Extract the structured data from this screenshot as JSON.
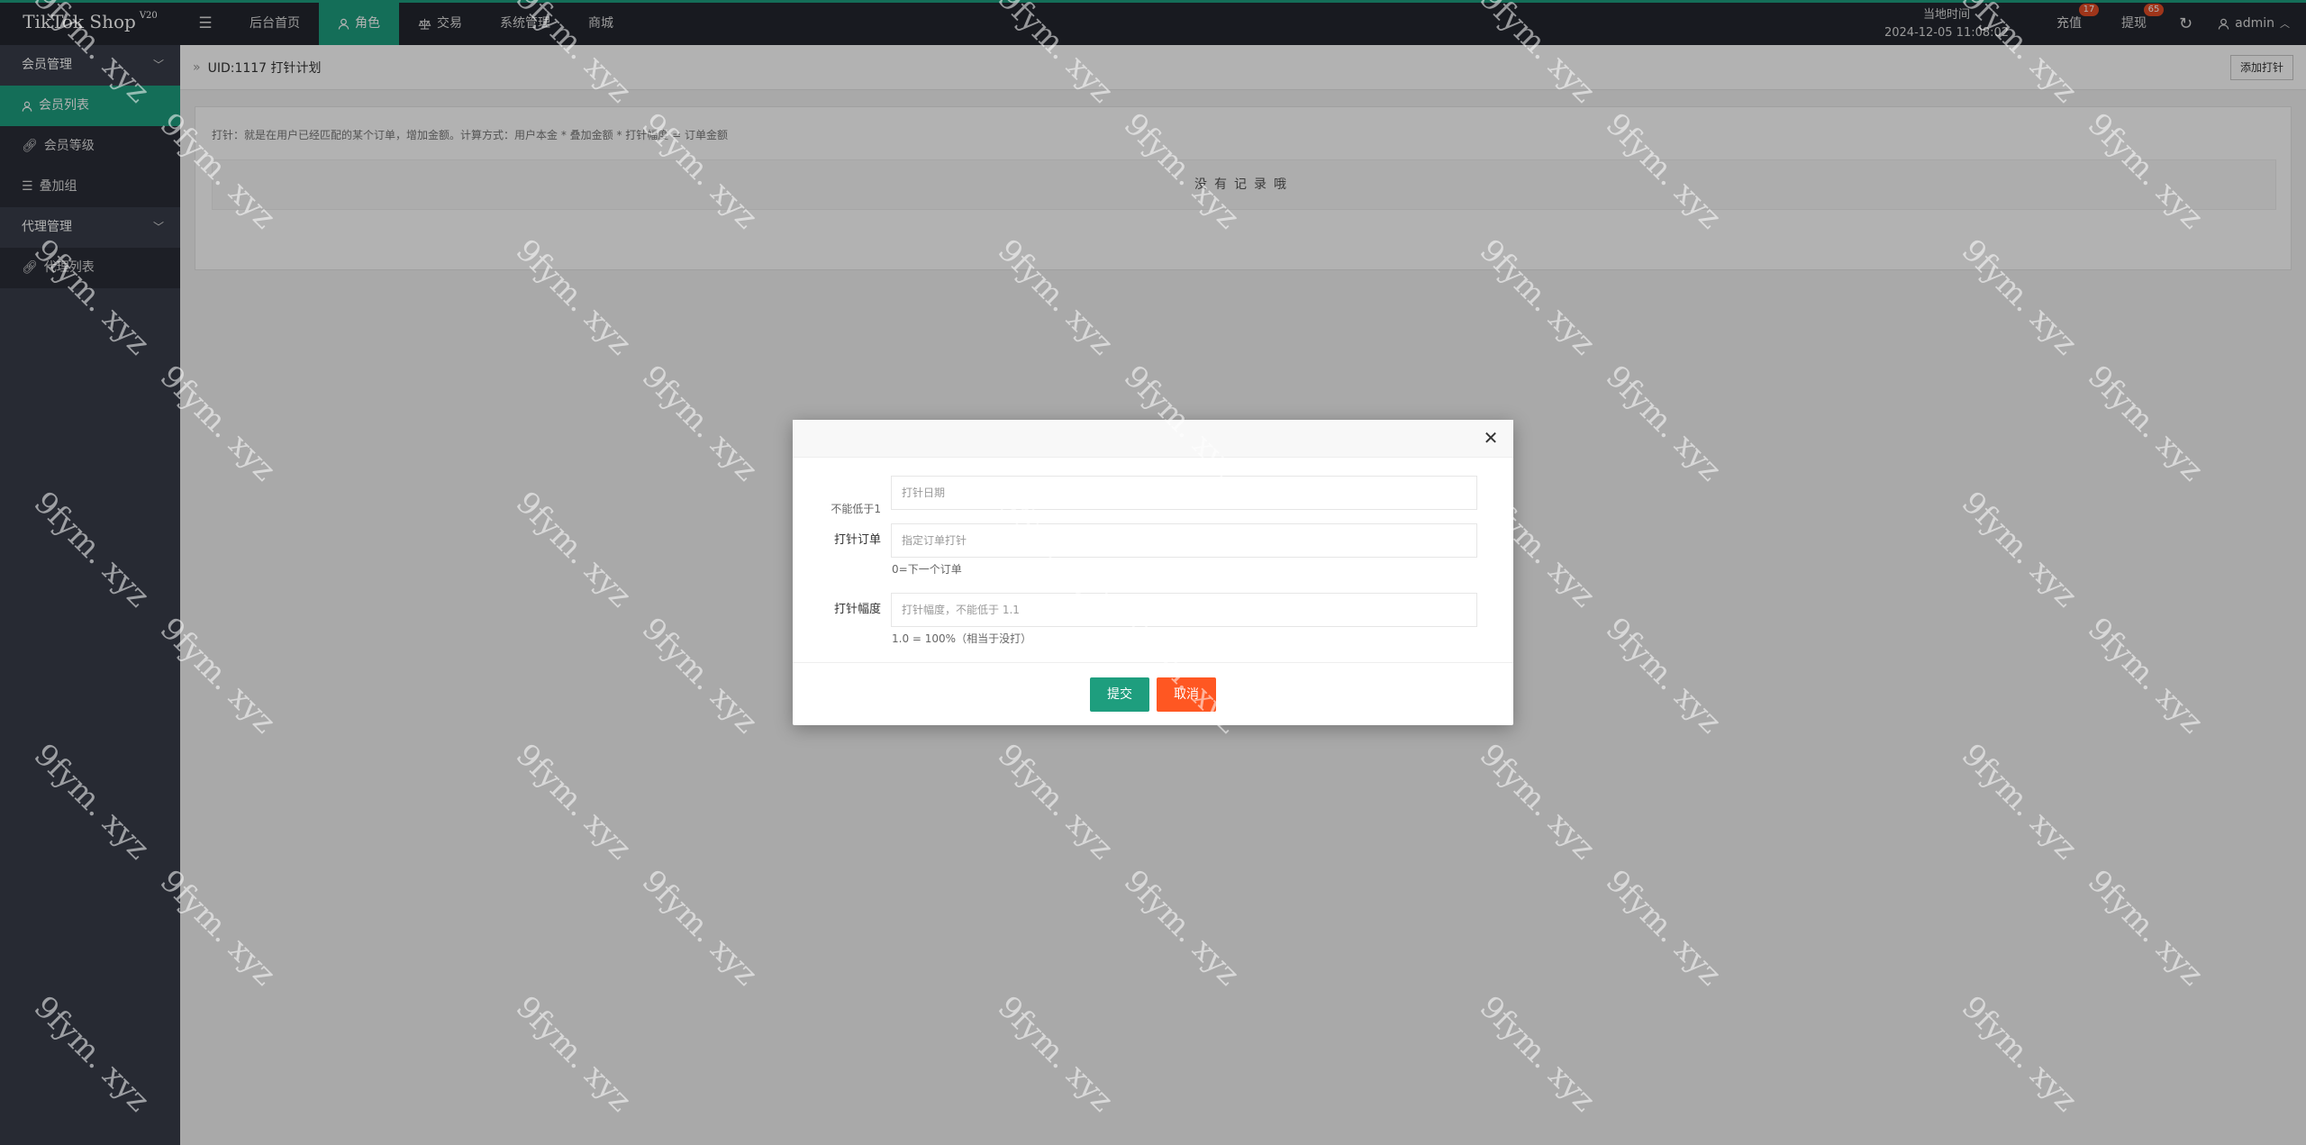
{
  "app": {
    "title": "TikTok Shop",
    "version": "V20"
  },
  "topnav": {
    "items": [
      {
        "label": "后台首页",
        "icon": ""
      },
      {
        "label": "角色",
        "icon": "user-icon"
      },
      {
        "label": "交易",
        "icon": "balance-icon"
      },
      {
        "label": "系统管理",
        "icon": ""
      },
      {
        "label": "商城",
        "icon": ""
      }
    ],
    "active_index": 1
  },
  "clock": {
    "label": "当地时间",
    "value": "2024-12-05 11:08:02"
  },
  "topright": {
    "recharge_label": "充值",
    "recharge_badge": "17",
    "withdraw_label": "提现",
    "withdraw_badge": "65",
    "user_label": "admin"
  },
  "sidebar": {
    "groups": [
      {
        "label": "会员管理",
        "items": [
          {
            "label": "会员列表",
            "icon": "user-icon"
          },
          {
            "label": "会员等级",
            "icon": "link-icon"
          },
          {
            "label": "叠加组",
            "icon": "list-icon"
          }
        ]
      },
      {
        "label": "代理管理",
        "items": [
          {
            "label": "代理列表",
            "icon": "link-icon"
          }
        ]
      }
    ],
    "active": "会员列表"
  },
  "page": {
    "breadcrumb": "UID:1117 打针计划",
    "add_button": "添加打针",
    "tip": "打针：就是在用户已经匹配的某个订单，增加金额。计算方式：用户本金 * 叠加金额 * 打针幅度 = 订单金额",
    "empty_text": "没有记录哦"
  },
  "modal": {
    "date_label": "不能低于1",
    "date_placeholder": "打针日期",
    "order_label": "打针订单",
    "order_placeholder": "指定订单打针",
    "order_hint": "0=下一个订单",
    "range_label": "打针幅度",
    "range_placeholder": "打针幅度，不能低于 1.1",
    "range_hint": "1.0 = 100%（相当于没打）",
    "submit": "提交",
    "cancel": "取消"
  },
  "watermark": {
    "text": "9fym. xyz"
  },
  "colors": {
    "accent": "#1e9e7e",
    "danger": "#ff5722",
    "topbar": "#23262e",
    "sidebar": "#393d49"
  }
}
